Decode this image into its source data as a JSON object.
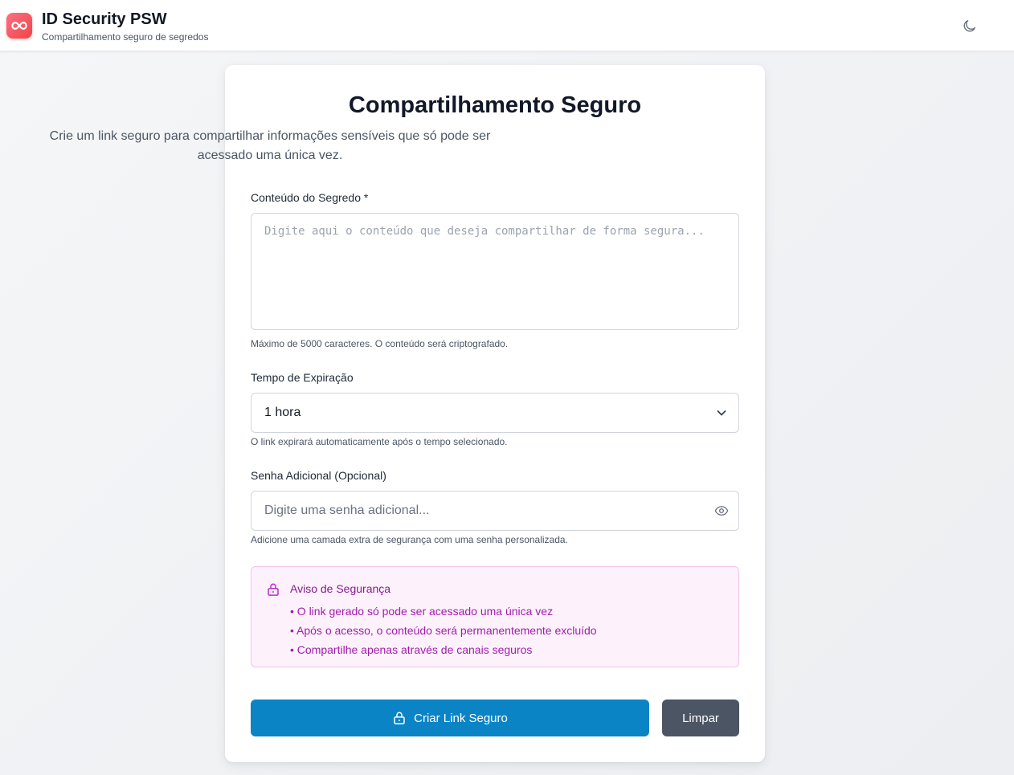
{
  "header": {
    "app_title": "ID Security PSW",
    "app_subtitle": "Compartilhamento seguro de segredos",
    "logo_icon": "infinity-icon",
    "theme_toggle_icon": "moon-icon"
  },
  "card": {
    "title": "Compartilhamento Seguro",
    "description": "Crie um link seguro para compartilhar informações sensíveis que só pode ser acessado uma única vez."
  },
  "secret": {
    "label": "Conteúdo do Segredo *",
    "placeholder": "Digite aqui o conteúdo que deseja compartilhar de forma segura...",
    "value": "",
    "hint": "Máximo de 5000 caracteres. O conteúdo será criptografado."
  },
  "expiration": {
    "label": "Tempo de Expiração",
    "selected": "1 hora",
    "hint": "O link expirará automaticamente após o tempo selecionado."
  },
  "password": {
    "label": "Senha Adicional (Opcional)",
    "placeholder": "Digite uma senha adicional...",
    "value": "",
    "hint": "Adicione uma camada extra de segurança com uma senha personalizada.",
    "toggle_icon": "eye-icon"
  },
  "warning": {
    "title": "Aviso de Segurança",
    "items": [
      "• O link gerado só pode ser acessado uma única vez",
      "• Após o acesso, o conteúdo será permanentemente excluído",
      "• Compartilhe apenas através de canais seguros"
    ],
    "icon": "lock-icon"
  },
  "actions": {
    "create_label": "Criar Link Seguro",
    "clear_label": "Limpar"
  },
  "colors": {
    "primary": "#0b84c6",
    "secondary": "#4b5563",
    "logo": "#ef4444",
    "warning_bg": "#fdf2fb",
    "warning_text": "#a21caf"
  }
}
